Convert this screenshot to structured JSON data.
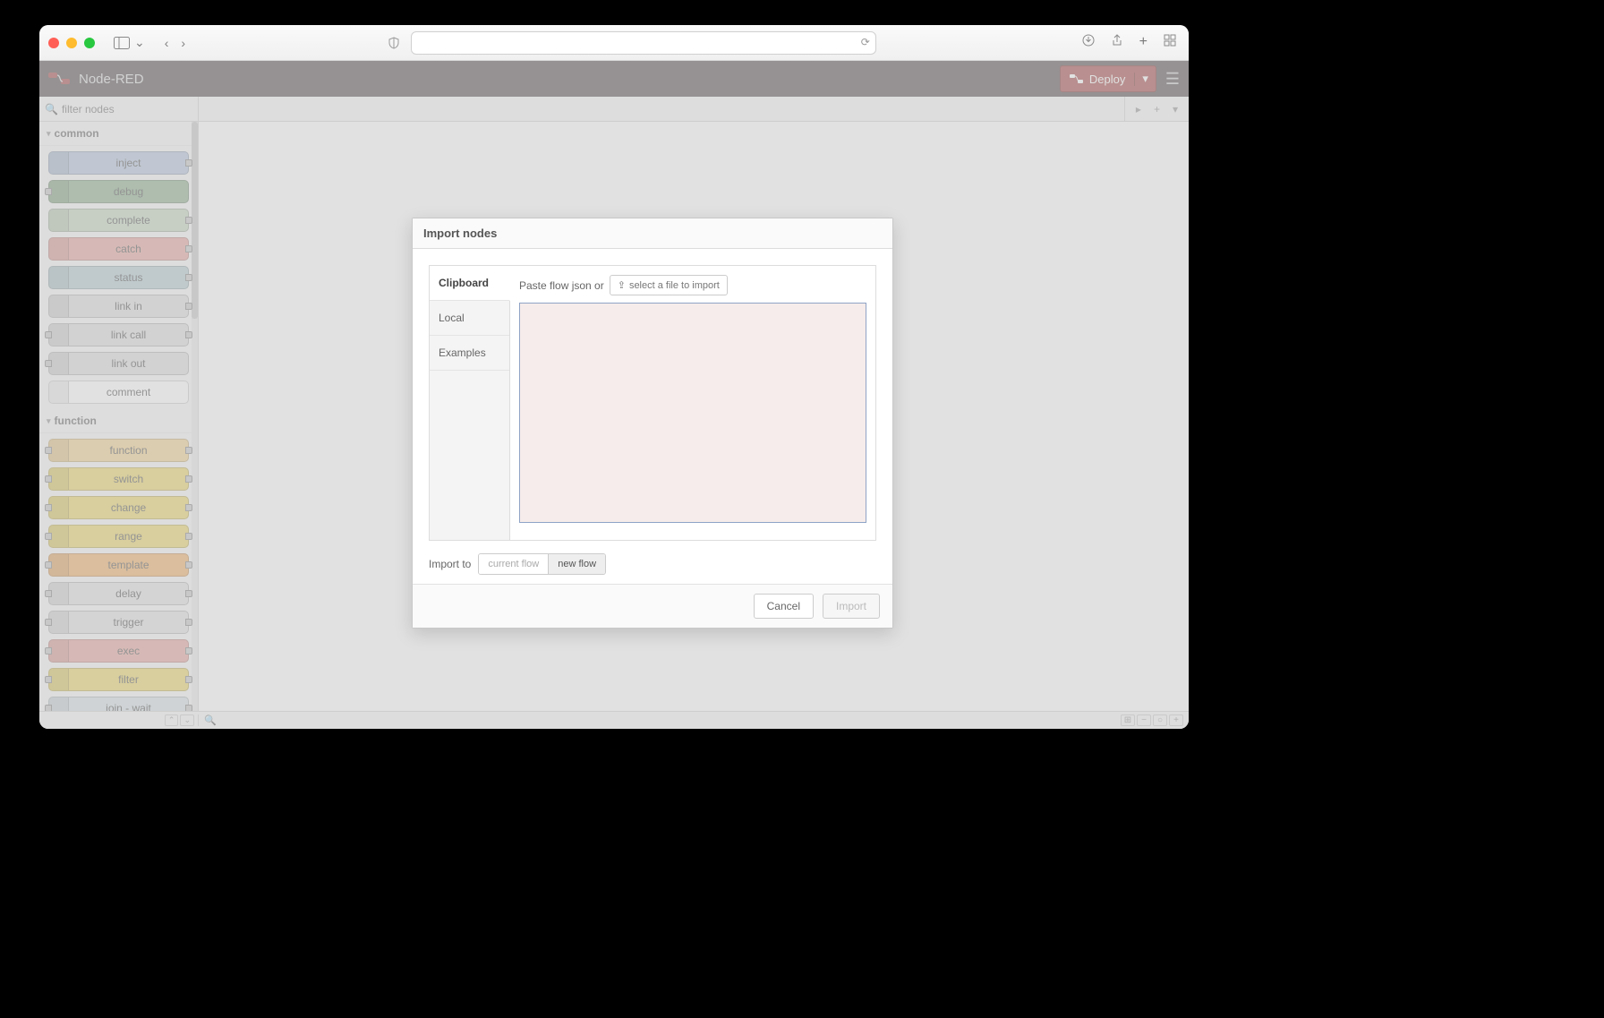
{
  "app": {
    "title": "Node-RED"
  },
  "toolbar": {
    "deploy": "Deploy"
  },
  "palette": {
    "filter_placeholder": "filter nodes",
    "categories": [
      {
        "name": "common",
        "nodes": [
          {
            "label": "inject",
            "bg": "#b6c6de",
            "ic": "arrow-in",
            "ports": "r"
          },
          {
            "label": "debug",
            "bg": "#8fb08f",
            "ic": "bars",
            "ports": "l"
          },
          {
            "label": "complete",
            "bg": "#c6d8c0",
            "ic": "bang",
            "ports": "r"
          },
          {
            "label": "catch",
            "bg": "#e6a7a0",
            "ic": "bang",
            "ports": "r"
          },
          {
            "label": "status",
            "bg": "#b7cdd3",
            "ic": "pulse",
            "ports": "r"
          },
          {
            "label": "link in",
            "bg": "#dedede",
            "ic": "link",
            "ports": "r"
          },
          {
            "label": "link call",
            "bg": "#dedede",
            "ic": "link",
            "ports": "lr"
          },
          {
            "label": "link out",
            "bg": "#dedede",
            "ic": "link",
            "ports": "l"
          },
          {
            "label": "comment",
            "bg": "#ffffff",
            "ic": "bubble",
            "ports": ""
          }
        ]
      },
      {
        "name": "function",
        "nodes": [
          {
            "label": "function",
            "bg": "#f2d291",
            "ic": "fn",
            "ports": "lr"
          },
          {
            "label": "switch",
            "bg": "#ead56a",
            "ic": "switch",
            "ports": "lr"
          },
          {
            "label": "change",
            "bg": "#ead56a",
            "ic": "change",
            "ports": "lr"
          },
          {
            "label": "range",
            "bg": "#ead56a",
            "ic": "range",
            "ports": "lr"
          },
          {
            "label": "template",
            "bg": "#f0b169",
            "ic": "brace",
            "ports": "lr"
          },
          {
            "label": "delay",
            "bg": "#e2e2e2",
            "ic": "clock",
            "ports": "lr"
          },
          {
            "label": "trigger",
            "bg": "#e2e2e2",
            "ic": "trig",
            "ports": "lr"
          },
          {
            "label": "exec",
            "bg": "#e6a7a0",
            "ic": "gear",
            "ports": "lr"
          },
          {
            "label": "filter",
            "bg": "#ead56a",
            "ic": "filter",
            "ports": "lr"
          },
          {
            "label": "join - wait",
            "bg": "#d7e0e4",
            "ic": "clock",
            "ports": "lr"
          }
        ]
      }
    ]
  },
  "modal": {
    "title": "Import nodes",
    "tabs": {
      "clipboard": "Clipboard",
      "local": "Local",
      "examples": "Examples"
    },
    "paste_label": "Paste flow json or",
    "file_btn": "select a file to import",
    "import_to_label": "Import to",
    "seg": {
      "current": "current flow",
      "new": "new flow"
    },
    "cancel": "Cancel",
    "import": "Import"
  }
}
